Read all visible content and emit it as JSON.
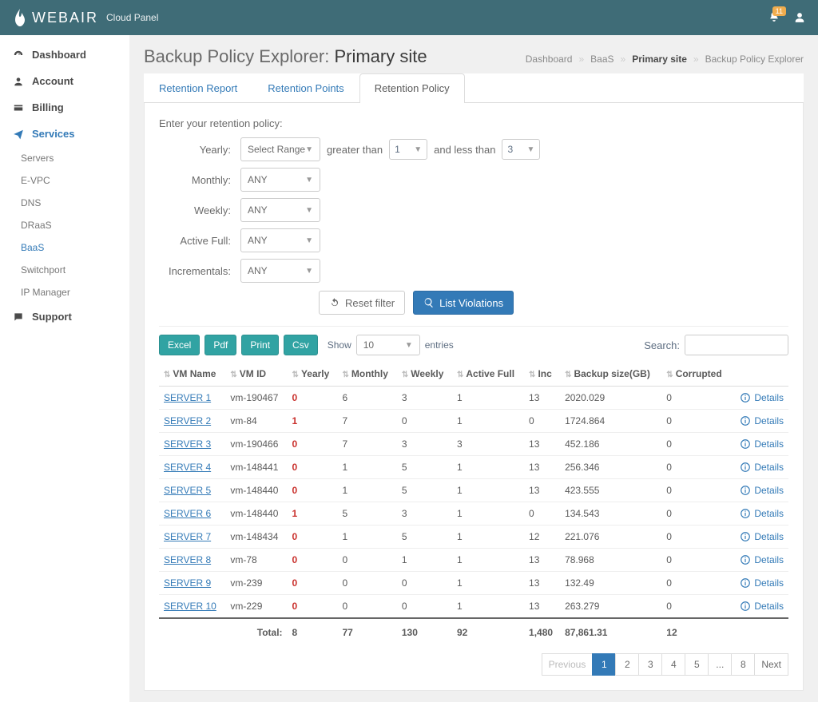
{
  "brand": {
    "name": "WEBAIR",
    "subtitle": "Cloud Panel"
  },
  "notifications": {
    "count": "11"
  },
  "nav": {
    "dashboard": "Dashboard",
    "account": "Account",
    "billing": "Billing",
    "services": "Services",
    "support": "Support",
    "sub": {
      "servers": "Servers",
      "evpc": "E-VPC",
      "dns": "DNS",
      "draas": "DRaaS",
      "baas": "BaaS",
      "switchport": "Switchport",
      "ipmanager": "IP Manager"
    }
  },
  "header": {
    "title_prefix": "Backup Policy Explorer: ",
    "title_main": "Primary site"
  },
  "breadcrumb": {
    "a": "Dashboard",
    "b": "BaaS",
    "c": "Primary site",
    "d": "Backup Policy Explorer"
  },
  "tabs": {
    "report": "Retention Report",
    "points": "Retention Points",
    "policy": "Retention Policy"
  },
  "filters": {
    "prompt": "Enter your retention policy:",
    "yearly_label": "Yearly:",
    "monthly_label": "Monthly:",
    "weekly_label": "Weekly:",
    "activefull_label": "Active Full:",
    "incrementals_label": "Incrementals:",
    "select_range": "Select Range",
    "any": "ANY",
    "greater_than": "greater than",
    "less_than": "and less than",
    "gt_val": "1",
    "lt_val": "3",
    "reset": "Reset filter",
    "list": "List Violations"
  },
  "toolbar": {
    "excel": "Excel",
    "pdf": "Pdf",
    "print": "Print",
    "csv": "Csv",
    "show": "Show",
    "entries_val": "10",
    "entries": "entries",
    "search_label": "Search:"
  },
  "columns": {
    "vmname": "VM Name",
    "vmid": "VM ID",
    "yearly": "Yearly",
    "monthly": "Monthly",
    "weekly": "Weekly",
    "activefull": "Active Full",
    "inc": "Inc",
    "backupsize": "Backup size(GB)",
    "corrupted": "Corrupted",
    "details": "Details"
  },
  "rows": [
    {
      "name": "SERVER 1",
      "vmid": "vm-190467",
      "yearly": "0",
      "monthly": "6",
      "weekly": "3",
      "af": "1",
      "inc": "13",
      "size": "2020.029",
      "corr": "0"
    },
    {
      "name": "SERVER 2",
      "vmid": "vm-84",
      "yearly": "1",
      "monthly": "7",
      "weekly": "0",
      "af": "1",
      "inc": "0",
      "size": "1724.864",
      "corr": "0"
    },
    {
      "name": "SERVER 3",
      "vmid": "vm-190466",
      "yearly": "0",
      "monthly": "7",
      "weekly": "3",
      "af": "3",
      "inc": "13",
      "size": "452.186",
      "corr": "0"
    },
    {
      "name": "SERVER 4",
      "vmid": "vm-148441",
      "yearly": "0",
      "monthly": "1",
      "weekly": "5",
      "af": "1",
      "inc": "13",
      "size": "256.346",
      "corr": "0"
    },
    {
      "name": "SERVER 5",
      "vmid": "vm-148440",
      "yearly": "0",
      "monthly": "1",
      "weekly": "5",
      "af": "1",
      "inc": "13",
      "size": "423.555",
      "corr": "0"
    },
    {
      "name": "SERVER 6",
      "vmid": "vm-148440",
      "yearly": "1",
      "monthly": "5",
      "weekly": "3",
      "af": "1",
      "inc": "0",
      "size": "134.543",
      "corr": "0"
    },
    {
      "name": "SERVER 7",
      "vmid": "vm-148434",
      "yearly": "0",
      "monthly": "1",
      "weekly": "5",
      "af": "1",
      "inc": "12",
      "size": "221.076",
      "corr": "0"
    },
    {
      "name": "SERVER 8",
      "vmid": "vm-78",
      "yearly": "0",
      "monthly": "0",
      "weekly": "1",
      "af": "1",
      "inc": "13",
      "size": "78.968",
      "corr": "0"
    },
    {
      "name": "SERVER 9",
      "vmid": "vm-239",
      "yearly": "0",
      "monthly": "0",
      "weekly": "0",
      "af": "1",
      "inc": "13",
      "size": "132.49",
      "corr": "0"
    },
    {
      "name": "SERVER 10",
      "vmid": "vm-229",
      "yearly": "0",
      "monthly": "0",
      "weekly": "0",
      "af": "1",
      "inc": "13",
      "size": "263.279",
      "corr": "0"
    }
  ],
  "totals": {
    "label": "Total:",
    "yearly": "8",
    "monthly": "77",
    "weekly": "130",
    "af": "92",
    "inc": "1,480",
    "size": "87,861.31",
    "corr": "12"
  },
  "pagination": {
    "prev": "Previous",
    "next": "Next",
    "pages": [
      "1",
      "2",
      "3",
      "4",
      "5",
      "...",
      "8"
    ]
  }
}
